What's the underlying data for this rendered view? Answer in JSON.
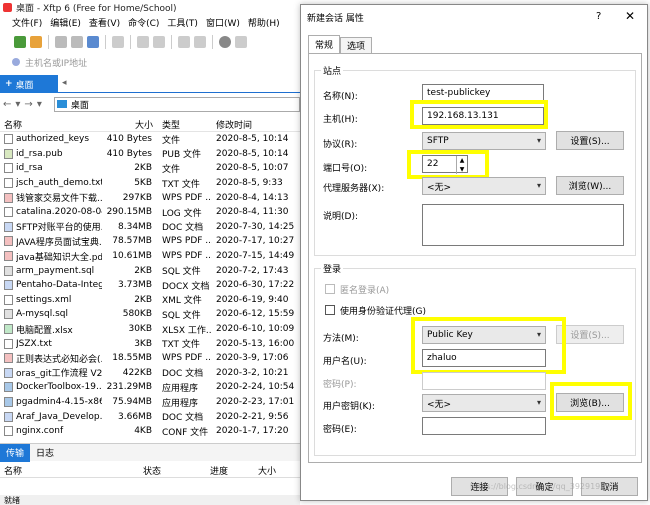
{
  "main": {
    "title": "桌面 - Xftp 6 (Free for Home/School)",
    "menu": [
      "文件(F)",
      "编辑(E)",
      "查看(V)",
      "命令(C)",
      "工具(T)",
      "窗口(W)",
      "帮助(H)"
    ],
    "address_placeholder": "主机名或IP地址",
    "tab_label": "桌面",
    "path": "桌面",
    "columns": {
      "name": "名称",
      "size": "大小",
      "type": "类型",
      "date": "修改时间"
    },
    "files": [
      {
        "name": "authorized_keys",
        "size": "410 Bytes",
        "type": "文件",
        "date": "2020-8-5, 10:14",
        "icon": "file-icon"
      },
      {
        "name": "id_rsa.pub",
        "size": "410 Bytes",
        "type": "PUB 文件",
        "date": "2020-8-5, 10:14",
        "icon": "pub-file-icon"
      },
      {
        "name": "id_rsa",
        "size": "2KB",
        "type": "文件",
        "date": "2020-8-5, 10:07",
        "icon": "file-icon"
      },
      {
        "name": "jsch_auth_demo.txt",
        "size": "5KB",
        "type": "TXT 文件",
        "date": "2020-8-5, 9:33",
        "icon": "txt-file-icon"
      },
      {
        "name": "钱管家交易文件下载...",
        "size": "297KB",
        "type": "WPS PDF ...",
        "date": "2020-8-4, 14:13",
        "icon": "pdf-file-icon"
      },
      {
        "name": "catalina.2020-08-04...",
        "size": "290.15MB",
        "type": "LOG 文件",
        "date": "2020-8-4, 11:30",
        "icon": "log-file-icon"
      },
      {
        "name": "SFTP对账平台的使用...",
        "size": "8.34MB",
        "type": "DOC 文档",
        "date": "2020-7-30, 14:25",
        "icon": "doc-file-icon"
      },
      {
        "name": "JAVA程序员面试宝典...",
        "size": "78.57MB",
        "type": "WPS PDF ...",
        "date": "2020-7-17, 10:27",
        "icon": "pdf-file-icon"
      },
      {
        "name": "java基础知识大全.pdf",
        "size": "10.61MB",
        "type": "WPS PDF ...",
        "date": "2020-7-15, 14:49",
        "icon": "pdf-file-icon"
      },
      {
        "name": "arm_payment.sql",
        "size": "2KB",
        "type": "SQL 文件",
        "date": "2020-7-2, 17:43",
        "icon": "sql-file-icon"
      },
      {
        "name": "Pentaho-Data-Integ...",
        "size": "3.73MB",
        "type": "DOCX 文档",
        "date": "2020-6-30, 17:22",
        "icon": "doc-file-icon"
      },
      {
        "name": "settings.xml",
        "size": "2KB",
        "type": "XML 文件",
        "date": "2020-6-19, 9:40",
        "icon": "xml-file-icon"
      },
      {
        "name": "A-mysql.sql",
        "size": "580KB",
        "type": "SQL 文件",
        "date": "2020-6-12, 15:59",
        "icon": "sql-file-icon"
      },
      {
        "name": "电脑配置.xlsx",
        "size": "30KB",
        "type": "XLSX 工作...",
        "date": "2020-6-10, 10:09",
        "icon": "xlsx-file-icon"
      },
      {
        "name": "JSZX.txt",
        "size": "3KB",
        "type": "TXT 文件",
        "date": "2020-5-13, 16:00",
        "icon": "txt-file-icon"
      },
      {
        "name": "正则表达式必知必会(...",
        "size": "18.55MB",
        "type": "WPS PDF ...",
        "date": "2020-3-9, 17:06",
        "icon": "pdf-file-icon"
      },
      {
        "name": "oras_git工作流程 V2...",
        "size": "422KB",
        "type": "DOC 文档",
        "date": "2020-3-2, 10:21",
        "icon": "doc-file-icon"
      },
      {
        "name": "DockerToolbox-19....",
        "size": "231.29MB",
        "type": "应用程序",
        "date": "2020-2-24, 10:54",
        "icon": "exe-file-icon"
      },
      {
        "name": "pgadmin4-4.15-x86...",
        "size": "75.94MB",
        "type": "应用程序",
        "date": "2020-2-23, 17:01",
        "icon": "exe-file-icon"
      },
      {
        "name": "Araf_Java_Develop...",
        "size": "3.66MB",
        "type": "DOC 文档",
        "date": "2020-2-21, 9:56",
        "icon": "doc-file-icon"
      },
      {
        "name": "nginx.conf",
        "size": "4KB",
        "type": "CONF 文件",
        "date": "2020-1-7, 17:20",
        "icon": "conf-file-icon"
      }
    ],
    "bottom_tabs": [
      "传输",
      "日志"
    ],
    "transfer_columns": {
      "name": "名称",
      "status": "状态",
      "progress": "进度",
      "size": "大小"
    },
    "status": "就绪"
  },
  "dialog": {
    "title": "新建会话 属性",
    "help": "?",
    "close": "✕",
    "tabs": [
      "常规",
      "选项"
    ],
    "site_group": "站点",
    "name_label": "名称(N):",
    "name_value": "test-publickey",
    "host_label": "主机(H):",
    "host_value": "192.168.13.131",
    "protocol_label": "协议(R):",
    "protocol_value": "SFTP",
    "settings_button": "设置(S)...",
    "port_label": "端口号(O):",
    "port_value": "22",
    "proxy_label": "代理服务器(X):",
    "proxy_value": "<无>",
    "browse_w_button": "浏览(W)...",
    "desc_label": "说明(D):",
    "login_group": "登录",
    "anon_label": "匿名登录(A)",
    "auth_agent_label": "使用身份验证代理(G)",
    "method_label": "方法(M):",
    "method_value": "Public Key",
    "method_settings_button": "设置(S)...",
    "user_label": "用户名(U):",
    "user_value": "zhaluo",
    "password_label": "密码(P):",
    "userkey_label": "用户密钥(K):",
    "userkey_value": "<无>",
    "browse_b_button": "浏览(B)...",
    "passphrase_label": "密码(E):",
    "connect_button": "连接",
    "ok_button": "确定",
    "cancel_button": "取消",
    "watermark": "https://blog.csdn.net/qq_39291929"
  },
  "colors": {
    "highlight": "#ffff00",
    "accent_tab": "#1e78d7"
  }
}
